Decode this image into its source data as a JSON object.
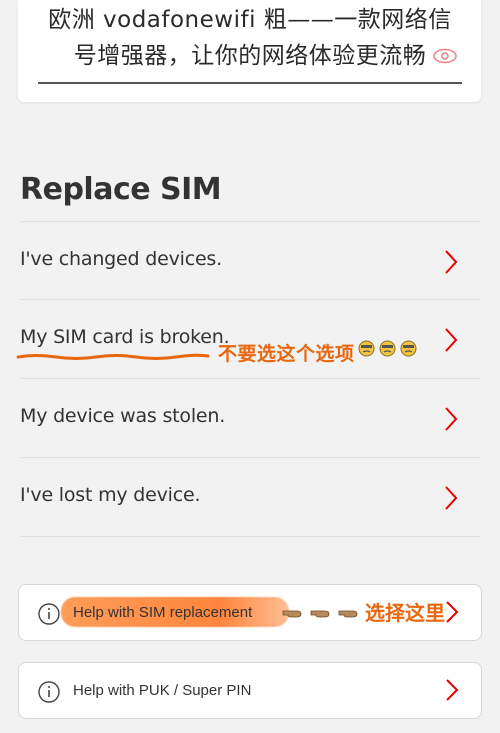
{
  "overlay": {
    "title_line1": "欧洲 vodafonewifi 粗——一款网络信",
    "title_line2": "号增强器，让你的网络体验更流畅"
  },
  "section": {
    "title": "Replace SIM"
  },
  "options": [
    {
      "label": "I've changed devices."
    },
    {
      "label": "My SIM card is broken."
    },
    {
      "label": "My device was stolen."
    },
    {
      "label": "I've lost my device."
    }
  ],
  "annotations": {
    "dont_choose": "不要选这个选项",
    "choose_here": "选择这里"
  },
  "help_links": [
    {
      "label": "Help with SIM replacement"
    },
    {
      "label": "Help with PUK / Super PIN"
    }
  ],
  "colors": {
    "accent_red": "#e60000",
    "annotation_orange": "#e8670f",
    "chevron": "#e60000"
  }
}
